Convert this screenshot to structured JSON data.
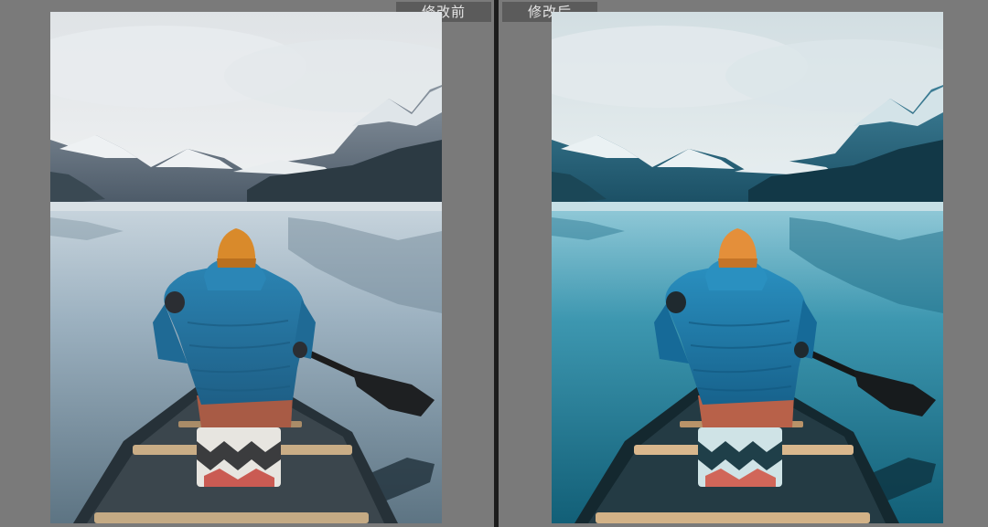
{
  "compare_view": {
    "before": {
      "label": "修改前",
      "style": "muted"
    },
    "after": {
      "label": "修改后",
      "style": "teal"
    }
  },
  "colors": {
    "background": "#7a7a7a",
    "divider": "#1c1c1c",
    "label_bg": "#5b5b5b",
    "label_text": "#e6e6e6"
  }
}
